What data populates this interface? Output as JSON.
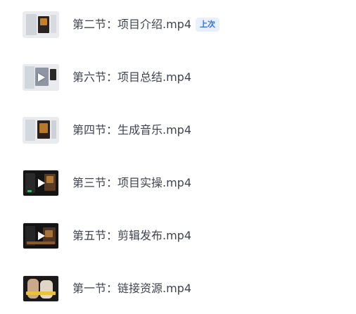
{
  "files": [
    {
      "name": "第二节：项目介绍.mp4",
      "thumbnail": "light-screen-thumbnail",
      "badge": "上次"
    },
    {
      "name": "第六节：项目总结.mp4",
      "thumbnail": "light-screen-play-thumbnail"
    },
    {
      "name": "第四节：生成音乐.mp4",
      "thumbnail": "light-screen-thumbnail"
    },
    {
      "name": "第三节：项目实操.mp4",
      "thumbnail": "dark-screen-play-thumbnail"
    },
    {
      "name": "第五节：剪辑发布.mp4",
      "thumbnail": "dark-screen-play-thumbnail"
    },
    {
      "name": "第一节：链接资源.mp4",
      "thumbnail": "photo-thumbnail"
    }
  ],
  "colors": {
    "text": "#3f4450",
    "badge_text": "#2f6bf0",
    "badge_bg": "#e8efff"
  }
}
